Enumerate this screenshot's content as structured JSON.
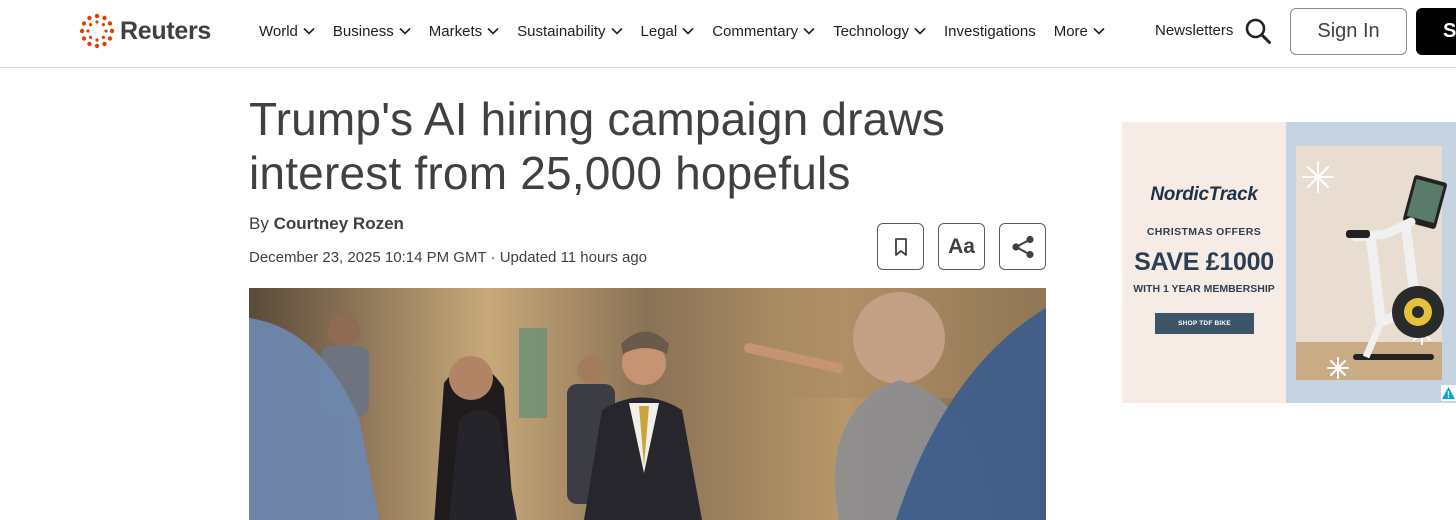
{
  "header": {
    "logo_text": "Reuters",
    "nav": [
      {
        "label": "World",
        "has_dropdown": true
      },
      {
        "label": "Business",
        "has_dropdown": true
      },
      {
        "label": "Markets",
        "has_dropdown": true
      },
      {
        "label": "Sustainability",
        "has_dropdown": true
      },
      {
        "label": "Legal",
        "has_dropdown": true
      },
      {
        "label": "Commentary",
        "has_dropdown": true
      },
      {
        "label": "Technology",
        "has_dropdown": true
      },
      {
        "label": "Investigations",
        "has_dropdown": false
      },
      {
        "label": "More",
        "has_dropdown": true
      }
    ],
    "newsletters_label": "Newsletters",
    "search_icon": "search-icon",
    "sign_in_label": "Sign In",
    "subscribe_label": "S"
  },
  "article": {
    "headline_line1": "Trump's AI hiring campaign draws",
    "headline_line2": "interest from 25,000 hopefuls",
    "byline_prefix": "By",
    "author": "Courtney Rozen",
    "date": "December 23, 2025 10:14 PM GMT",
    "separator": "·",
    "updated": "Updated 11 hours ago",
    "tools": {
      "bookmark_icon": "bookmark-icon",
      "font_size_label": "Aa",
      "share_icon": "share-icon"
    }
  },
  "ad": {
    "brand": "NordicTrack",
    "subheading": "CHRISTMAS OFFERS",
    "headline": "SAVE £1000",
    "membership": "WITH 1 YEAR MEMBERSHIP",
    "cta": "SHOP TDF BIKE",
    "choices_icon": "ad-choices-icon"
  },
  "colors": {
    "text": "#404040",
    "logo_dots": "#dc4300",
    "subscribe_bg": "#000000",
    "ad_cta_bg": "#3d5568"
  }
}
